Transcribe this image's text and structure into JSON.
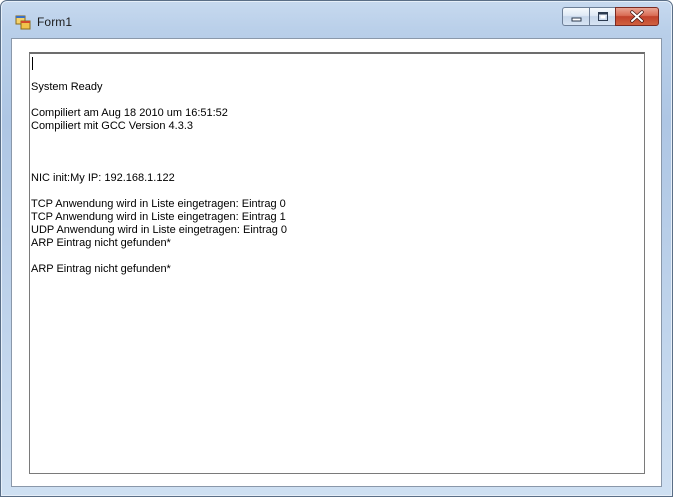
{
  "window": {
    "title": "Form1"
  },
  "icons": {
    "app": "form-app-icon",
    "minimize": "minimize-icon",
    "maximize": "maximize-icon",
    "close": "close-icon"
  },
  "colors": {
    "close_button": "#c1412b",
    "frame": "#b9cfe9"
  },
  "textbox": {
    "lines": [
      "System Ready",
      "",
      "Compiliert am Aug 18 2010 um 16:51:52",
      "Compiliert mit GCC Version 4.3.3",
      "",
      "",
      "",
      "NIC init:My IP: 192.168.1.122",
      "",
      "TCP Anwendung wird in Liste eingetragen: Eintrag 0",
      "TCP Anwendung wird in Liste eingetragen: Eintrag 1",
      "UDP Anwendung wird in Liste eingetragen: Eintrag 0",
      "ARP Eintrag nicht gefunden*",
      "",
      "ARP Eintrag nicht gefunden*"
    ]
  }
}
